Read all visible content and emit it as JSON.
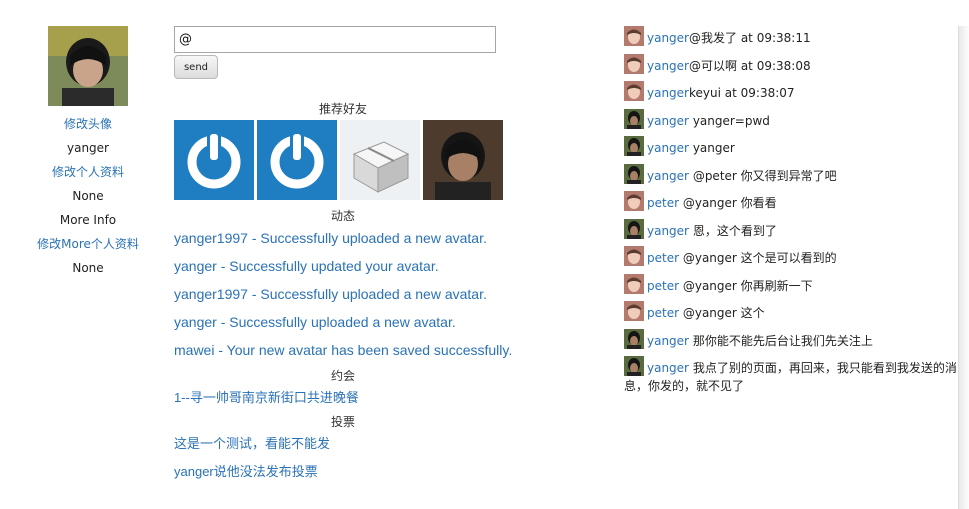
{
  "profile": {
    "change_avatar": "修改头像",
    "username": "yanger",
    "edit_profile": "修改个人资料",
    "profile_value": "None",
    "more_info_label": "More Info",
    "edit_more_profile": "修改More个人资料",
    "more_value": "None"
  },
  "composer": {
    "input_value": "@",
    "send_label": "send"
  },
  "sections": {
    "recommended_friends": "推荐好友",
    "activity": "动态",
    "dates": "约会",
    "votes": "投票"
  },
  "friends": [
    {
      "icon": "power-avatar-icon"
    },
    {
      "icon": "power-avatar-icon"
    },
    {
      "icon": "box-avatar-icon"
    },
    {
      "icon": "photo-avatar-icon"
    }
  ],
  "activity": [
    "yanger1997 - Successfully uploaded a new avatar.",
    "yanger - Successfully updated your avatar.",
    "yanger1997 - Successfully uploaded a new avatar.",
    "yanger - Successfully uploaded a new avatar.",
    "mawei - Your new avatar has been saved successfully."
  ],
  "dates": [
    "1--寻一帅哥南京新街口共进晚餐"
  ],
  "votes": [
    "这是一个测试，看能不能发",
    "yanger说他没法发布投票"
  ],
  "chat": [
    {
      "user": "yanger",
      "avatar": "face",
      "text": "@我发了 at 09:38:11"
    },
    {
      "user": "yanger",
      "avatar": "face",
      "text": "@可以啊 at 09:38:08"
    },
    {
      "user": "yanger",
      "avatar": "face",
      "text": "keyui at 09:38:07"
    },
    {
      "user": "yanger",
      "avatar": "photo",
      "text": " yanger=pwd"
    },
    {
      "user": "yanger",
      "avatar": "photo",
      "text": " yanger"
    },
    {
      "user": "yanger",
      "avatar": "photo",
      "text": " @peter 你又得到异常了吧"
    },
    {
      "user": "peter",
      "avatar": "face",
      "text": " @yanger 你看看"
    },
    {
      "user": "yanger",
      "avatar": "photo",
      "text": " 恩，这个看到了"
    },
    {
      "user": "peter",
      "avatar": "face",
      "text": " @yanger 这个是可以看到的"
    },
    {
      "user": "peter",
      "avatar": "face",
      "text": " @yanger 你再刷新一下"
    },
    {
      "user": "peter",
      "avatar": "face",
      "text": " @yanger 这个"
    },
    {
      "user": "yanger",
      "avatar": "photo",
      "text": " 那你能不能先后台让我们先关注上"
    },
    {
      "user": "yanger",
      "avatar": "photo",
      "text": " 我点了别的页面，再回来，我只能看到我发送的消息，你发的，就不见了"
    }
  ]
}
